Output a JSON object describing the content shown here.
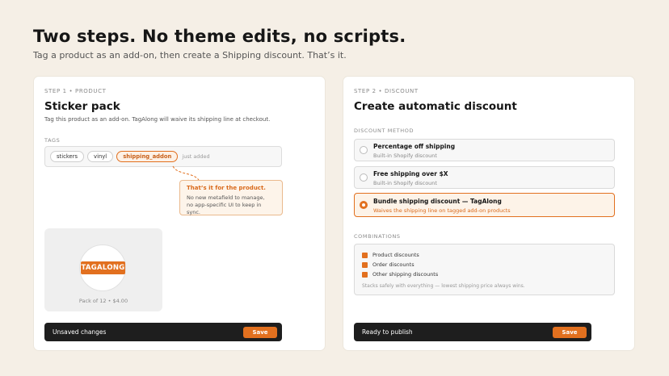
{
  "header": {
    "title": "Two steps. No theme edits, no scripts.",
    "subtitle": "Tag a product as an add-on, then create a Shipping discount. That’s it."
  },
  "left": {
    "step": "STEP 1 • PRODUCT",
    "title": "Sticker pack",
    "description": "Tag this product as an add-on. TagAlong will waive its shipping line at checkout.",
    "tags_label": "TAGS",
    "tags": [
      "stickers",
      "vinyl",
      "shipping_addon"
    ],
    "just_added": "just added",
    "tip": {
      "title": "That’s it for the product.",
      "line1": "No new metafield to manage,",
      "line2": "no app-specific UI to keep in sync."
    },
    "product": {
      "logo": "TAGALONG",
      "caption": "Pack of 12 • $4.00"
    },
    "bar": {
      "status": "Unsaved changes",
      "save_label": "Save"
    }
  },
  "right": {
    "step": "STEP 2 • DISCOUNT",
    "title": "Create automatic discount",
    "method_label": "DISCOUNT METHOD",
    "options": [
      {
        "title": "Percentage off shipping",
        "subtitle": "Built-in Shopify discount",
        "selected": false
      },
      {
        "title": "Free shipping over $X",
        "subtitle": "Built-in Shopify discount",
        "selected": false
      },
      {
        "title": "Bundle shipping discount — TagAlong",
        "subtitle": "Waives the shipping line on tagged add-on products",
        "selected": true
      }
    ],
    "combinations_label": "COMBINATIONS",
    "combinations": [
      "Product discounts",
      "Order discounts",
      "Other shipping discounts"
    ],
    "combinations_note": "Stacks safely with everything — lowest shipping price always wins.",
    "bar": {
      "status": "Ready to publish",
      "save_label": "Save"
    }
  },
  "colors": {
    "accent": "#e2701f",
    "background": "#f5efe6",
    "bar": "#1e1e1e"
  }
}
